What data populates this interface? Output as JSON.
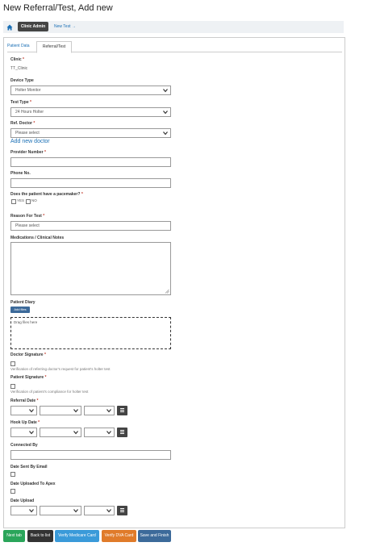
{
  "page": {
    "title": "New Referral/Test, Add new"
  },
  "breadcrumb": {
    "home_icon": "home-icon",
    "clinic_admin": "Clinic Admin",
    "new_test": "New Test →"
  },
  "tabs": [
    "Patient Data",
    "Referral/Test"
  ],
  "form": {
    "clinic_label": "Clinic",
    "clinic_value": "TT_Clinic",
    "device_type_label": "Device Type",
    "device_type_value": "Holter Monitor",
    "test_type_label": "Test Type",
    "test_type_value": "24 Hours Holter",
    "ref_doctor_label": "Ref. Doctor",
    "ref_doctor_value": "Please select",
    "add_new_doctor": "Add new doctor",
    "provider_number_label": "Provider Number",
    "phone_label": "Phone No.",
    "pacemaker_label": "Does the patient have a pacemaker?",
    "pacemaker_yes": "YES",
    "pacemaker_no": "NO",
    "reason_label": "Reason For Test",
    "reason_placeholder": "Please select",
    "notes_label": "Medications / Clinical Notes",
    "diary_label": "Patient Diary",
    "add_files": "Add files",
    "drop_text": "Drag files here",
    "doctor_sig_label": "Doctor Signature",
    "doctor_sig_hint": "Verification of referring doctor's request for patient's holter test",
    "patient_sig_label": "Patient Signature",
    "patient_sig_hint": "Verification of patient's compliance for holter test",
    "referral_date_label": "Referral Date",
    "hookup_date_label": "Hook Up Date",
    "connected_by_label": "Connected By",
    "date_sent_label": "Date Sent By Email",
    "date_uploaded_label": "Date Uploaded To Apex",
    "date_upload_label": "Date Upload",
    "required_mark": "*"
  },
  "buttons": {
    "next_tab": "Next tab",
    "back_to_list": "Back to list",
    "verify_medicare": "Verify Medicare Card",
    "verify_dva": "Verify DVA Card",
    "save_finish": "Save and Finish"
  },
  "colors": {
    "next": "#2aa55a",
    "back": "#333333",
    "medicare": "#3a9ad9",
    "dva": "#e07b2a",
    "save": "#3c6a9a",
    "req": "#c0392b"
  }
}
